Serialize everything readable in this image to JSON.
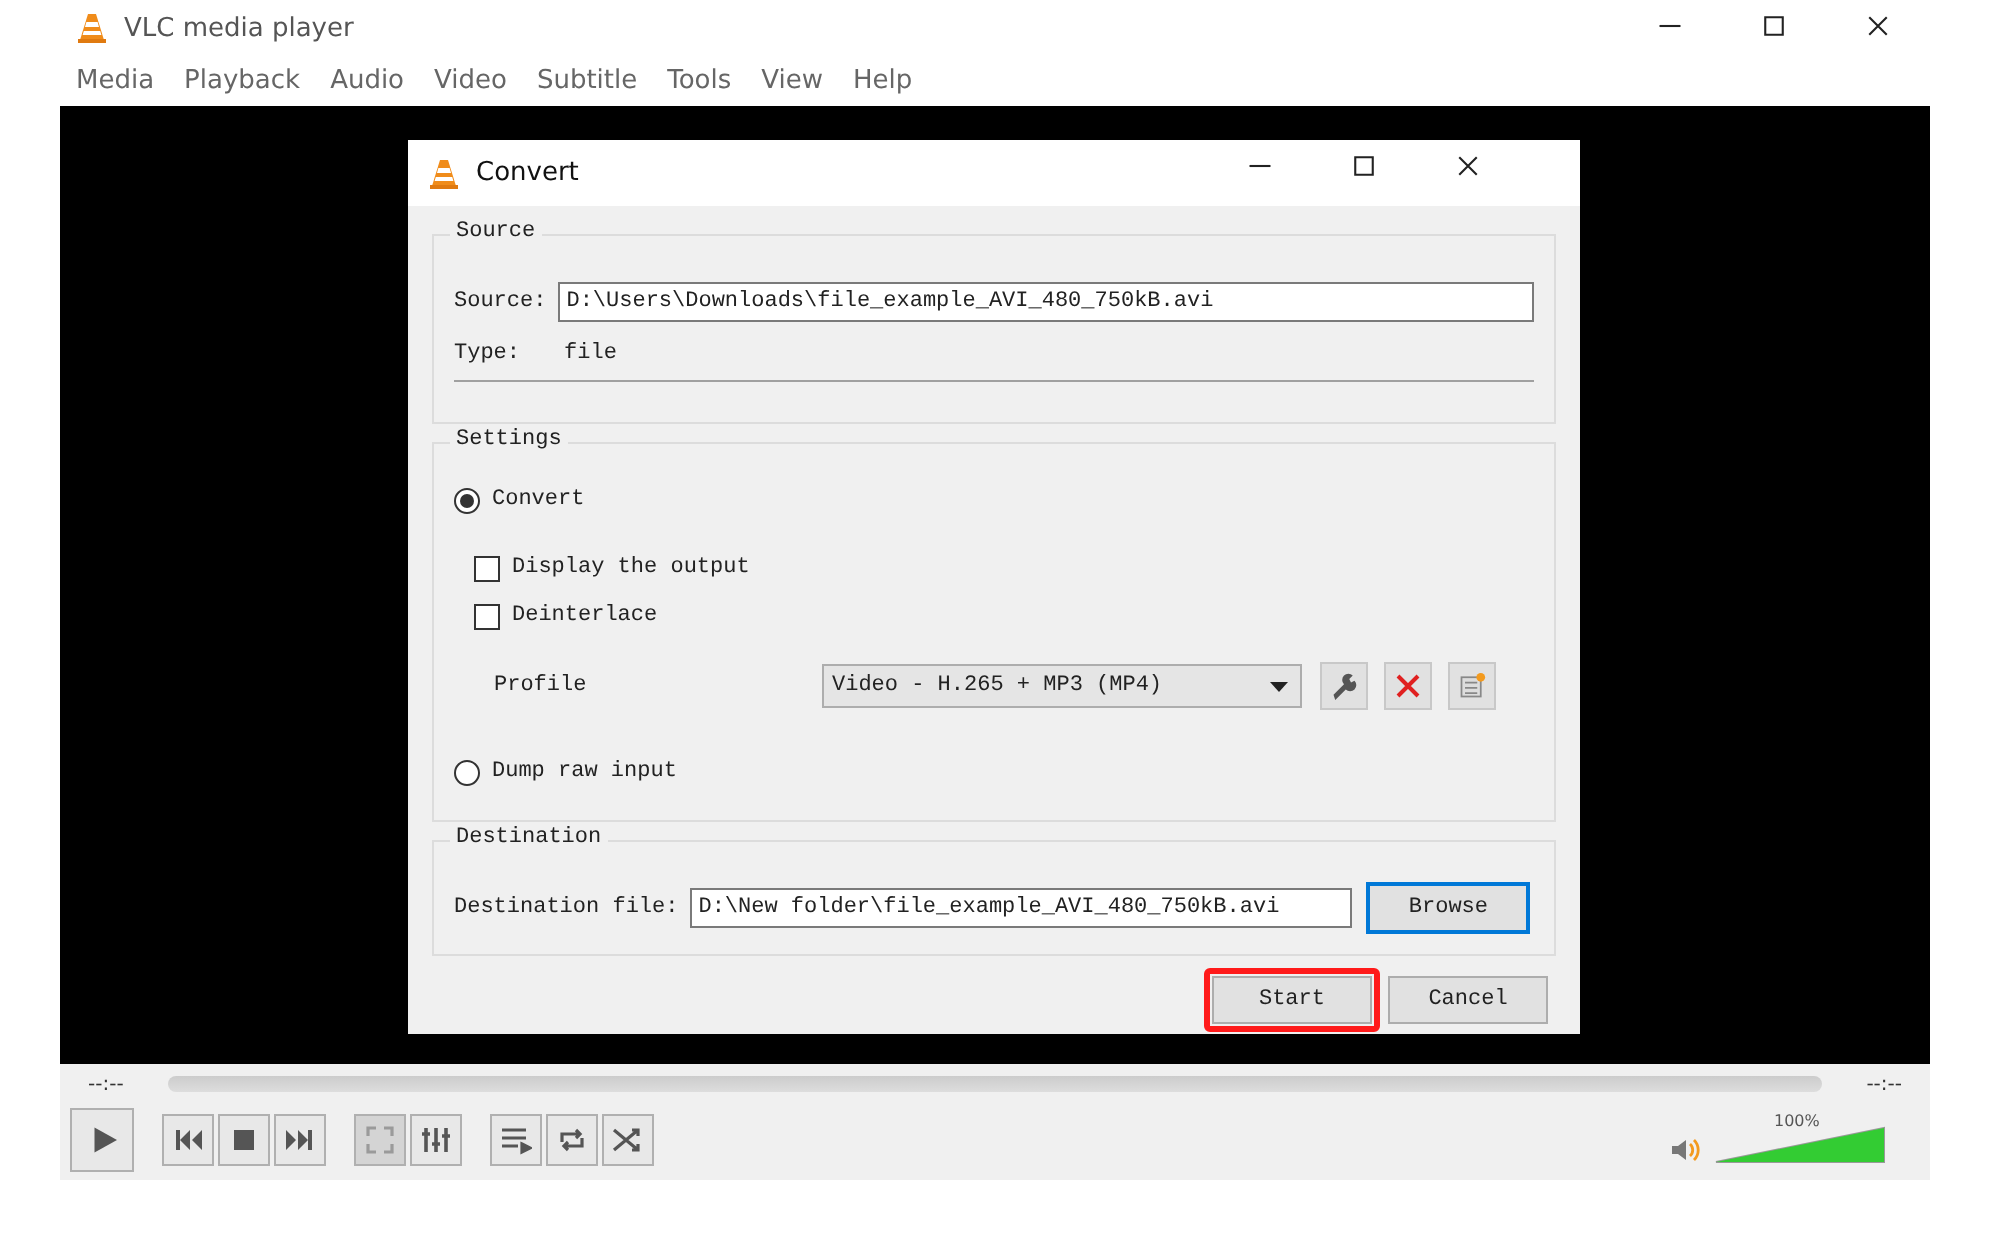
{
  "window": {
    "title": "VLC media player"
  },
  "menu": [
    {
      "label": "Media"
    },
    {
      "label": "Playback"
    },
    {
      "label": "Audio"
    },
    {
      "label": "Video"
    },
    {
      "label": "Subtitle"
    },
    {
      "label": "Tools"
    },
    {
      "label": "View"
    },
    {
      "label": "Help"
    }
  ],
  "dialog": {
    "title": "Convert",
    "source": {
      "legend": "Source",
      "source_label": "Source:",
      "source_value": "D:\\Users\\Downloads\\file_example_AVI_480_750kB.avi",
      "type_label": "Type:",
      "type_value": "file"
    },
    "settings": {
      "legend": "Settings",
      "convert": {
        "label": "Convert",
        "selected": true
      },
      "options": [
        {
          "label": "Display the output",
          "checked": false
        },
        {
          "label": "Deinterlace",
          "checked": false
        }
      ],
      "profile_label": "Profile",
      "profile_value": "Video - H.265 + MP3 (MP4)",
      "dump": {
        "label": "Dump raw input",
        "selected": false
      }
    },
    "destination": {
      "legend": "Destination",
      "label": "Destination file:",
      "value": "D:\\New folder\\file_example_AVI_480_750kB.avi",
      "browse": "Browse"
    },
    "buttons": [
      {
        "label": "Start",
        "highlighted": true
      },
      {
        "label": "Cancel",
        "highlighted": false
      }
    ]
  },
  "player": {
    "elapsed": "--:--",
    "remaining": "--:--",
    "seek": {
      "level": 0
    },
    "controls": [
      {
        "kind": "play",
        "disabled": false
      },
      {
        "kind": "gap"
      },
      {
        "kind": "prev",
        "disabled": false
      },
      {
        "kind": "stop",
        "disabled": false
      },
      {
        "kind": "next",
        "disabled": false
      },
      {
        "kind": "gap"
      },
      {
        "kind": "fullscreen",
        "disabled": true
      },
      {
        "kind": "extended",
        "disabled": false
      },
      {
        "kind": "gap"
      },
      {
        "kind": "playlist",
        "disabled": false
      },
      {
        "kind": "loop",
        "disabled": false
      },
      {
        "kind": "shuffle",
        "disabled": false
      }
    ],
    "volume": {
      "reading": "100%",
      "level": 1
    }
  }
}
